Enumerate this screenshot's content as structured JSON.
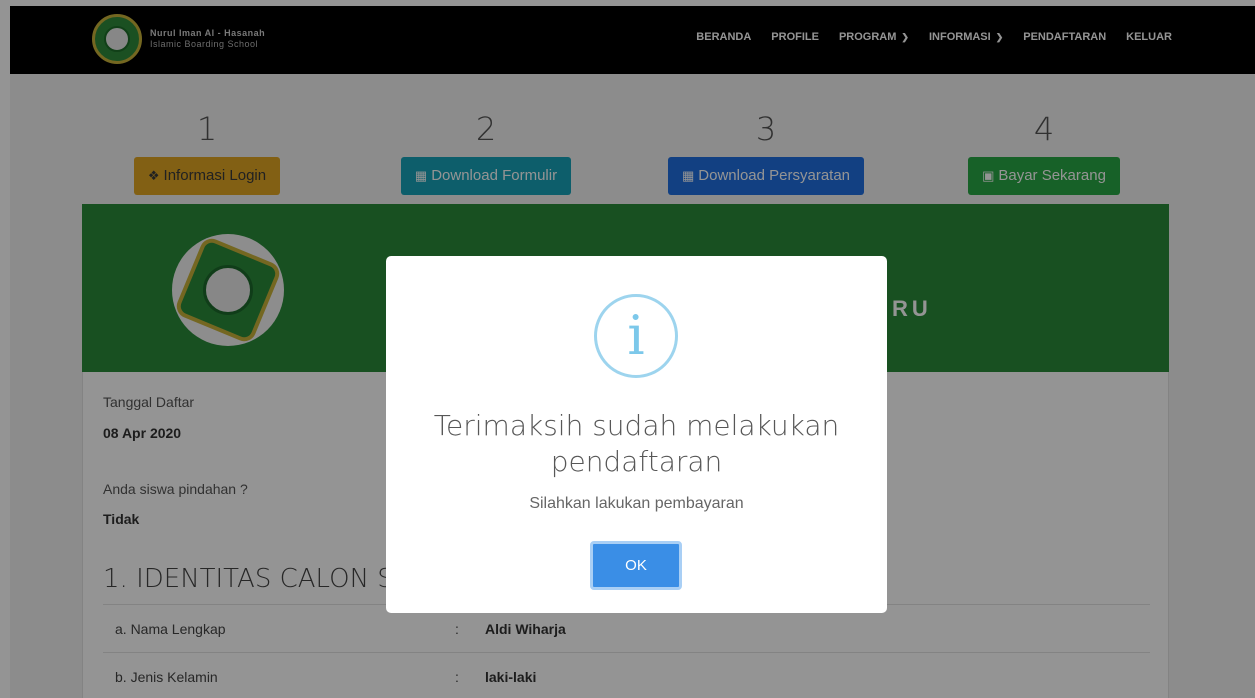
{
  "navbar": {
    "brand_line1": "Nurul Iman Al - Hasanah",
    "brand_line2": "Islamic Boarding School",
    "menu": [
      {
        "label": "BERANDA"
      },
      {
        "label": "PROFILE"
      },
      {
        "label": "PROGRAM"
      },
      {
        "label": "INFORMASI"
      },
      {
        "label": "PENDAFTARAN"
      },
      {
        "label": "KELUAR"
      }
    ]
  },
  "steps": [
    {
      "number": "1",
      "button": "Informasi Login",
      "icon": "info-circle-icon",
      "color": "#f0ad4e"
    },
    {
      "number": "2",
      "button": "Download Formulir",
      "icon": "pdf-file-icon",
      "color": "#17a2b8"
    },
    {
      "number": "3",
      "button": "Download Persyaratan",
      "icon": "pdf-file-icon",
      "color": "#1f6fe0"
    },
    {
      "number": "4",
      "button": "Bayar Sekarang",
      "icon": "money-icon",
      "color": "#28a745"
    }
  ],
  "banner": {
    "title_visible": "RU"
  },
  "registration": {
    "date_label": "Tanggal Daftar",
    "date_value": "08 Apr 2020",
    "transfer_label": "Anda siswa pindahan ?",
    "transfer_value": "Tidak",
    "section_title": "1. IDENTITAS CALON S",
    "rows": [
      {
        "key": "a. Nama Lengkap",
        "sep": ":",
        "value": "Aldi Wiharja"
      },
      {
        "key": "b. Jenis Kelamin",
        "sep": ":",
        "value": "laki-laki"
      }
    ]
  },
  "modal": {
    "icon": "info-icon",
    "title": "Terimaksih sudah melakukan pendaftaran",
    "text": "Silahkan lakukan pembayaran",
    "ok_label": "OK"
  }
}
